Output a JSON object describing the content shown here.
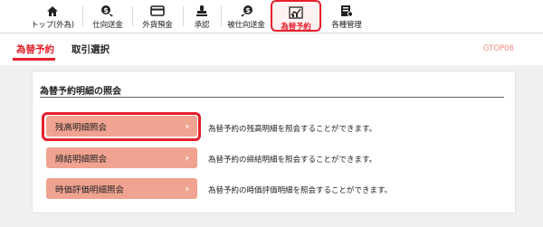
{
  "nav": {
    "items": [
      {
        "label": "トップ(外為)",
        "icon": "home-icon"
      },
      {
        "label": "仕向送金",
        "icon": "dollar-send-icon"
      },
      {
        "label": "外貨預金",
        "icon": "card-icon"
      },
      {
        "label": "承認",
        "icon": "stamp-icon"
      },
      {
        "label": "被仕向送金",
        "icon": "dollar-receive-icon"
      },
      {
        "label": "為替予約",
        "icon": "chart-icon"
      },
      {
        "label": "各種管理",
        "icon": "settings-doc-icon"
      }
    ],
    "active_index": 5
  },
  "page": {
    "title": "為替予約",
    "subtitle": "取引選択",
    "screen_id": "GTOP06"
  },
  "panel": {
    "heading": "為替予約明細の照会",
    "rows": [
      {
        "button": "残高明細照会",
        "description": "為替予約の残高明細を照会することができます。",
        "highlighted": true
      },
      {
        "button": "締結明細照会",
        "description": "為替予約の締結明細を照会することができます。",
        "highlighted": false
      },
      {
        "button": "時価評価明細照会",
        "description": "為替予約の時価評価明細を照会することができます。",
        "highlighted": false
      }
    ]
  },
  "colors": {
    "accent_red": "#e51f2d",
    "button_salmon": "#f0a390",
    "screen_id": "#f08a7d",
    "background_gray": "#f0f0f0"
  }
}
